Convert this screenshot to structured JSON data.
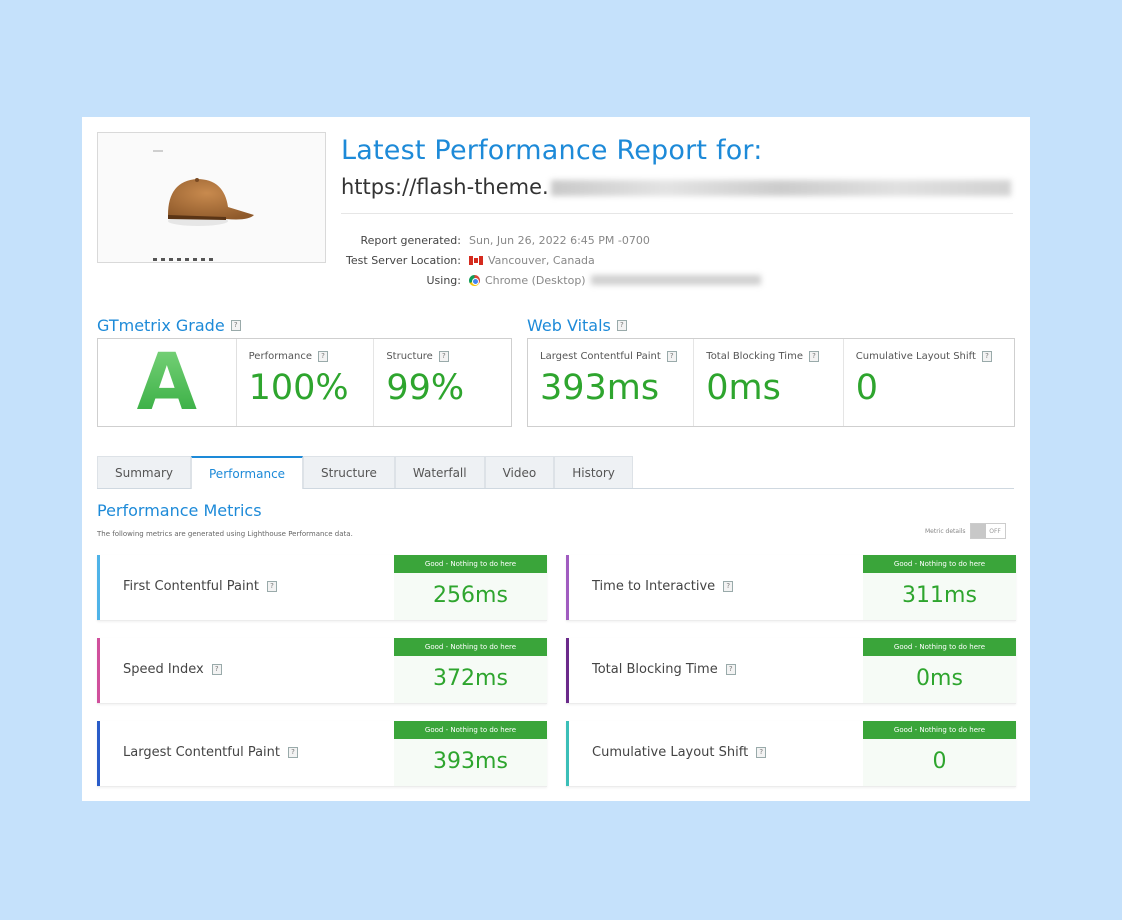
{
  "header": {
    "title": "Latest Performance Report for:",
    "url": "https://flash-theme."
  },
  "meta": {
    "report_generated_label": "Report generated:",
    "report_generated_value": "Sun, Jun 26, 2022 6:45 PM -0700",
    "server_label": "Test Server Location:",
    "server_value": "Vancouver, Canada",
    "using_label": "Using:",
    "using_value": "Chrome (Desktop)"
  },
  "grade": {
    "title": "GTmetrix Grade",
    "letter": "A",
    "performance_label": "Performance",
    "performance_value": "100%",
    "structure_label": "Structure",
    "structure_value": "99%"
  },
  "vitals": {
    "title": "Web Vitals",
    "lcp_label": "Largest Contentful Paint",
    "lcp_value": "393ms",
    "tbt_label": "Total Blocking Time",
    "tbt_value": "0ms",
    "cls_label": "Cumulative Layout Shift",
    "cls_value": "0"
  },
  "tabs": [
    "Summary",
    "Performance",
    "Structure",
    "Waterfall",
    "Video",
    "History"
  ],
  "active_tab": "Performance",
  "performance_metrics": {
    "title": "Performance Metrics",
    "subtitle": "The following metrics are generated using Lighthouse Performance data.",
    "toggle_label": "Metric details",
    "toggle_state": "OFF",
    "items": [
      {
        "name": "First Contentful Paint",
        "badge": "Good - Nothing to do here",
        "value": "256ms",
        "color": "#4fb3e8"
      },
      {
        "name": "Time to Interactive",
        "badge": "Good - Nothing to do here",
        "value": "311ms",
        "color": "#a05cc0"
      },
      {
        "name": "Speed Index",
        "badge": "Good - Nothing to do here",
        "value": "372ms",
        "color": "#d0509c"
      },
      {
        "name": "Total Blocking Time",
        "badge": "Good - Nothing to do here",
        "value": "0ms",
        "color": "#6a2a8a"
      },
      {
        "name": "Largest Contentful Paint",
        "badge": "Good - Nothing to do here",
        "value": "393ms",
        "color": "#2a5cc8"
      },
      {
        "name": "Cumulative Layout Shift",
        "badge": "Good - Nothing to do here",
        "value": "0",
        "color": "#3bbfb8"
      }
    ]
  },
  "help_glyph": "?",
  "colors": {
    "accent": "#1d8ad8",
    "good": "#3aa53a",
    "background": "#c5e1fb"
  }
}
